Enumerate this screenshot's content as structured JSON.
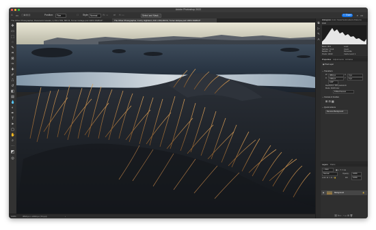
{
  "window": {
    "title": "Adobe Photoshop 2022"
  },
  "options_bar": {
    "position_label": "Position:",
    "position_value": "Fine",
    "style_label": "Style:",
    "style_value": "Normal",
    "select_mask_label": "Select and Mask...",
    "share_label": "Share"
  },
  "tabs": [
    {
      "label": "The Other Photographer, Panoramic Header, 1,743 x 563, 895 M, Turner Collage.psd 100% RGB/16*"
    },
    {
      "label": "The Other Photographer, Fuzzy Highland, 243 x 463,493 M, Turner Eclipse.psd 100% RGB/16*"
    }
  ],
  "status": {
    "zoom": "100%",
    "doc": "3840 px x 2160 px (72 ppi)"
  },
  "panels": {
    "top_tabs": [
      "Histogram",
      "Color",
      "Swatches",
      "Gradients",
      "Patterns"
    ],
    "histogram_channel": "RGB",
    "hist_info": {
      "mean_label": "Mean:",
      "mean": "95.9",
      "std_label": "Std Dev:",
      "std": "73.10",
      "median_label": "Median:",
      "median": "76",
      "pixels_label": "Pixels:",
      "pixels": "10010",
      "level_label": "Level:",
      "count_label": "Count:",
      "percentile_label": "Percentile:",
      "cache_label": "Cache Level:",
      "cache": "1"
    },
    "prop_tabs": [
      "Properties",
      "Adjustments",
      "Libraries"
    ],
    "pixel_layer": "Pixel Layer",
    "transform": "Transform",
    "w_label": "W",
    "w": "3840 px",
    "h_label": "H",
    "h": "2160 px",
    "x_label": "X",
    "x": "0 px",
    "y_label": "Y",
    "y": "0 px",
    "angle": "0.00°",
    "resolution": "Resolution: 300 pixels/inch",
    "mode": "Mode: RGB Color",
    "depth": "8 Bits/Channel",
    "guides": "Canvas & Guides",
    "quick_actions": "Quick Actions",
    "remove_bg": "Remove Background",
    "layers_tabs": [
      "Layers",
      "Paths"
    ],
    "kind_label": "Kind",
    "blend": "Normal",
    "opacity_label": "Opacity:",
    "opacity": "100%",
    "fill_label": "Fill:",
    "fill": "100%",
    "lock_label": "Lock:",
    "layer_name": "Background"
  }
}
